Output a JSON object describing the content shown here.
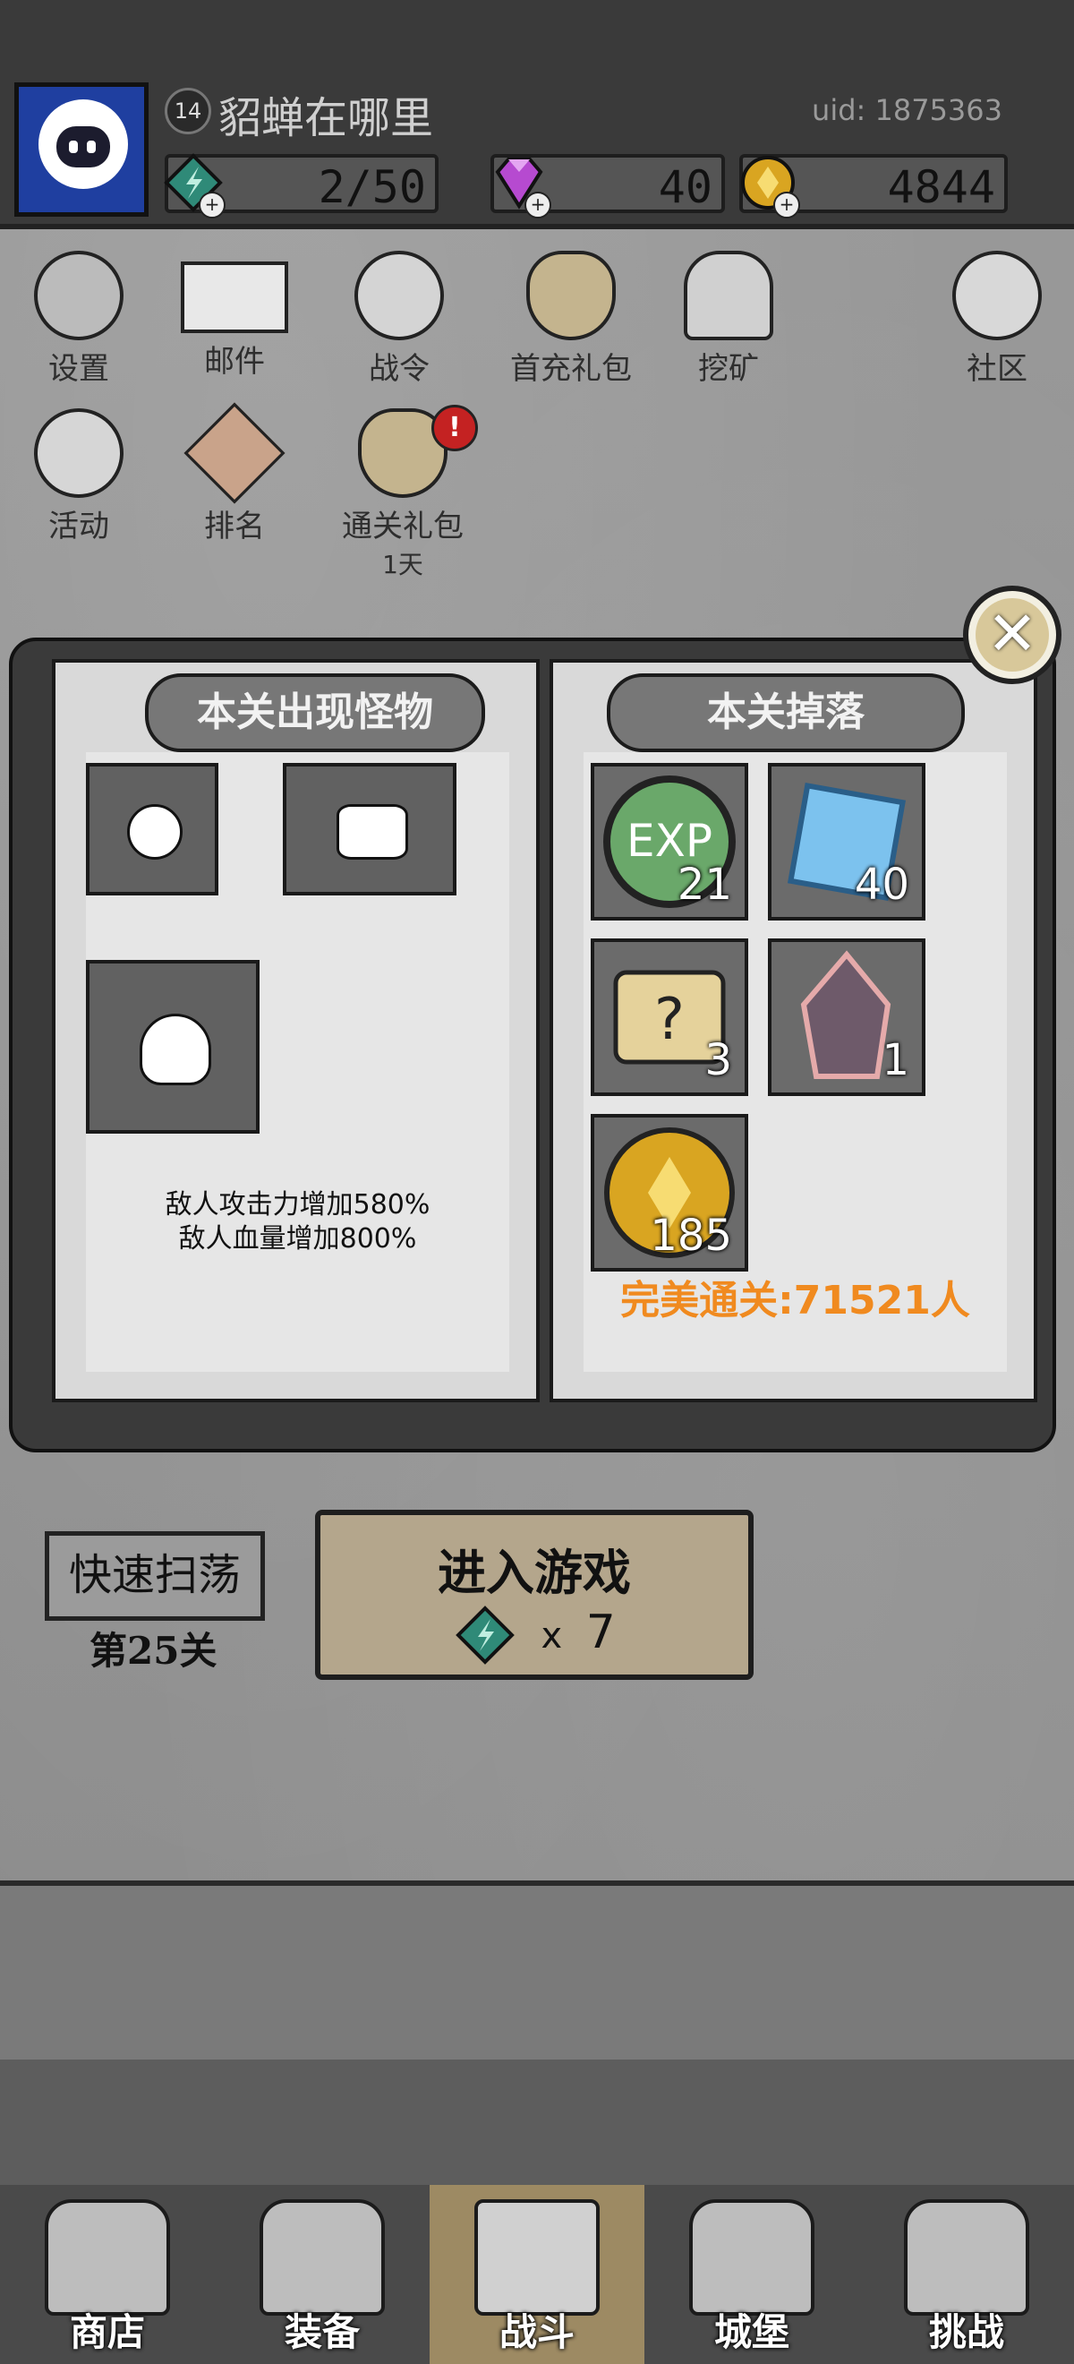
{
  "player": {
    "level": "14",
    "name": "貂蝉在哪里",
    "uid": "uid: 1875363"
  },
  "resources": {
    "energy": "2/50",
    "gems": "40",
    "gold": "4844"
  },
  "menu": {
    "row1": [
      "设置",
      "邮件",
      "战令",
      "首充礼包",
      "挖矿",
      "社区"
    ],
    "row2": [
      "活动",
      "排名",
      "通关礼包"
    ],
    "gift_sub": "1天",
    "gift_badge": "!"
  },
  "book": {
    "left_title": "本关出现怪物",
    "right_title": "本关掉落",
    "buff_1": "敌人攻击力增加580%",
    "buff_2": "敌人血量增加800%",
    "drops": [
      {
        "icon": "exp-icon",
        "label": "EXP",
        "count": "21"
      },
      {
        "icon": "diamond-icon",
        "count": "40"
      },
      {
        "icon": "scroll-icon",
        "count": "3"
      },
      {
        "icon": "crystal-icon",
        "count": "1"
      },
      {
        "icon": "gold-coin-icon",
        "count": "185"
      }
    ],
    "perfect": "完美通关:71521人"
  },
  "controls": {
    "sweep": "快速扫荡",
    "stage": "第25关",
    "enter": "进入游戏",
    "cost_x": "x",
    "cost_val": "7"
  },
  "nav": [
    "商店",
    "装备",
    "战斗",
    "城堡",
    "挑战"
  ],
  "colors": {
    "accent_orange": "#f08a1f",
    "badge_red": "#c42222",
    "active_tab": "#9d8a63"
  }
}
